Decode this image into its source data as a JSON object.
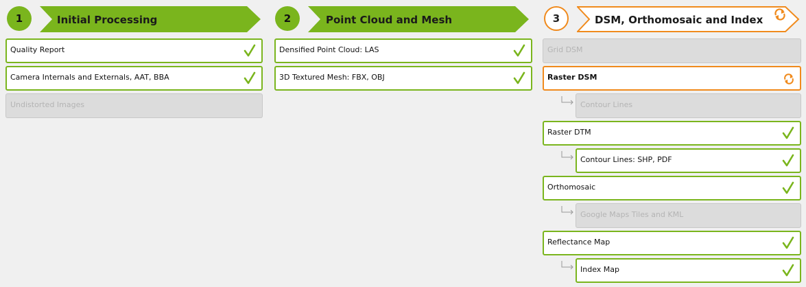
{
  "columns": [
    {
      "number": "1",
      "title": "Initial Processing",
      "items": [
        {
          "label": "Quality Report",
          "status": "done"
        },
        {
          "label": "Camera Internals and Externals, AAT, BBA",
          "status": "done"
        },
        {
          "label": "Undistorted Images",
          "status": "disabled"
        }
      ]
    },
    {
      "number": "2",
      "title": "Point Cloud and Mesh",
      "items": [
        {
          "label": "Densified Point Cloud: LAS",
          "status": "done"
        },
        {
          "label": "3D Textured Mesh: FBX, OBJ",
          "status": "done"
        }
      ]
    },
    {
      "number": "3",
      "title": "DSM, Orthomosaic and Index",
      "status": "running",
      "items": [
        {
          "label": "Grid DSM",
          "status": "disabled"
        },
        {
          "label": "Raster DSM",
          "status": "running"
        },
        {
          "label": "Contour Lines",
          "status": "disabled",
          "sub": true
        },
        {
          "label": "Raster DTM",
          "status": "done"
        },
        {
          "label": "Contour Lines: SHP, PDF",
          "status": "done",
          "sub": true
        },
        {
          "label": "Orthomosaic",
          "status": "done"
        },
        {
          "label": "Google Maps Tiles and KML",
          "status": "disabled",
          "sub": true
        },
        {
          "label": "Reflectance Map",
          "status": "done"
        },
        {
          "label": "Index Map",
          "status": "done",
          "sub": true
        }
      ]
    }
  ],
  "colors": {
    "done": "#7ab51d",
    "running": "#f08a1c",
    "disabled": "#c8c8c8"
  },
  "icons": {
    "done": "check-icon",
    "running": "refresh-icon"
  }
}
